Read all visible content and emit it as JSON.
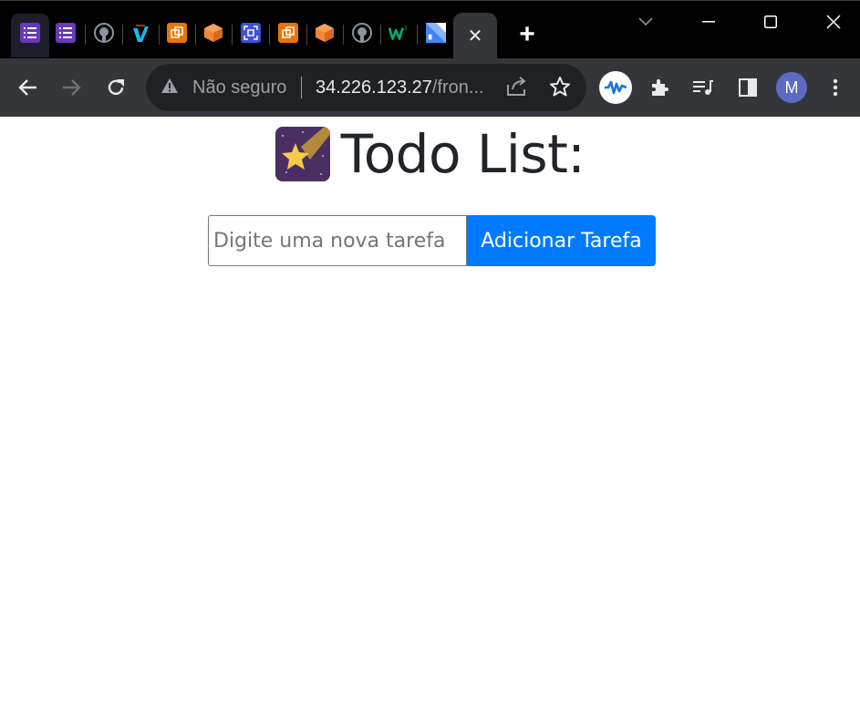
{
  "browser": {
    "tabs": [
      {
        "icon": "list-form-icon",
        "color": "#673ab7"
      },
      {
        "icon": "list-form-icon",
        "color": "#673ab7"
      },
      {
        "icon": "github-icon",
        "color": "#ffffff"
      },
      {
        "icon": "vimeo-icon",
        "color": "#1ab7ea"
      },
      {
        "icon": "aws-copy-icon",
        "color": "#e8750a"
      },
      {
        "icon": "aws-cube-icon",
        "color": "#f58536"
      },
      {
        "icon": "aws-scan-icon",
        "color": "#3f51d4"
      },
      {
        "icon": "aws-copy-icon",
        "color": "#e8750a"
      },
      {
        "icon": "aws-cube-icon",
        "color": "#f58536"
      },
      {
        "icon": "github-icon",
        "color": "#ffffff"
      },
      {
        "icon": "w3schools-icon",
        "color": "#04aa6d"
      },
      {
        "icon": "docs-map-icon",
        "color": "#4285f4"
      }
    ],
    "active_tab_close": "✕",
    "new_tab": "+",
    "security_label": "Não seguro",
    "url_host": "34.226.123.27",
    "url_path": "/fron...",
    "profile_initial": "M"
  },
  "page": {
    "title": "Todo List:",
    "title_icon": "shooting-star-icon",
    "input_placeholder": "Digite uma nova tarefa",
    "input_value": "",
    "add_button_label": "Adicionar Tarefa"
  },
  "colors": {
    "tabstrip_bg": "#000000",
    "toolbar_bg": "#35363a",
    "omnibox_bg": "#202124",
    "primary_button": "#007bff",
    "heading_text": "#212529"
  }
}
